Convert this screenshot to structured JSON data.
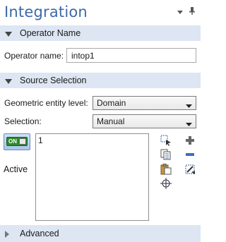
{
  "header": {
    "title": "Integration"
  },
  "sections": {
    "operator": "Operator Name",
    "source": "Source Selection",
    "advanced": "Advanced"
  },
  "operator": {
    "name_label": "Operator name:",
    "name_value": "intop1"
  },
  "source": {
    "entity_label": "Geometric entity level:",
    "entity_value": "Domain",
    "selection_label": "Selection:",
    "selection_value": "Manual",
    "active_label": "Active",
    "toggle_text": "ON",
    "list_items": [
      "1"
    ]
  },
  "colors": {
    "title": "#3d6aa6",
    "section_bg": "#dde6f2",
    "toggle_on": "#2b8a2b"
  }
}
